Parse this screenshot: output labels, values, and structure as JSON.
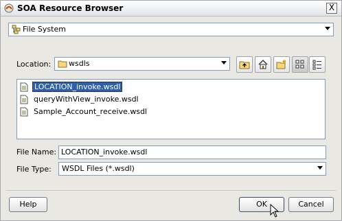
{
  "window": {
    "title": "SOA Resource Browser",
    "close_label": "X"
  },
  "connection": {
    "selected": "File System"
  },
  "location": {
    "label": "Location:",
    "selected": "wsdls"
  },
  "toolbar": {
    "up_icon": "folder-up-icon",
    "home_icon": "home-icon",
    "new_folder_icon": "new-folder-icon",
    "icon_view_icon": "icon-view-icon",
    "list_view_icon": "list-view-icon"
  },
  "files": [
    {
      "name": "LOCATION_invoke.wsdl",
      "selected": true
    },
    {
      "name": "queryWithView_invoke.wsdl",
      "selected": false
    },
    {
      "name": "Sample_Account_receive.wsdl",
      "selected": false
    }
  ],
  "file_name": {
    "label": "File Name:",
    "value": "LOCATION_invoke.wsdl"
  },
  "file_type": {
    "label": "File Type:",
    "selected": "WSDL Files (*.wsdl)"
  },
  "buttons": {
    "help": "Help",
    "ok": "OK",
    "cancel": "Cancel"
  }
}
